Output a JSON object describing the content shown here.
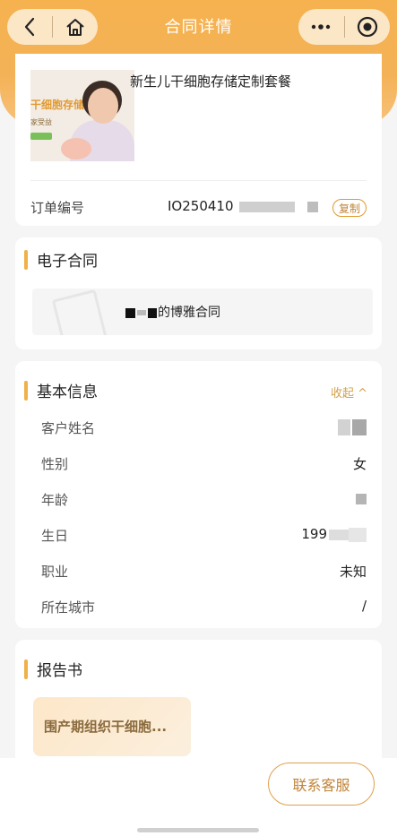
{
  "nav": {
    "title": "合同详情"
  },
  "product": {
    "name": "新生儿干细胞存储定制套餐",
    "image_text": "干细胞存储",
    "image_sub": "家受益",
    "order_label": "订单编号",
    "order_value": "IO250410",
    "copy_label": "复制"
  },
  "contract": {
    "section_title": "电子合同",
    "name": "的博雅合同"
  },
  "basic": {
    "section_title": "基本信息",
    "collapse_label": "收起 ^",
    "rows": [
      {
        "label": "客户姓名",
        "value": ""
      },
      {
        "label": "性别",
        "value": "女"
      },
      {
        "label": "年龄",
        "value": ""
      },
      {
        "label": "生日",
        "value": "199"
      },
      {
        "label": "职业",
        "value": "未知"
      },
      {
        "label": "所在城市",
        "value": "/"
      }
    ]
  },
  "report": {
    "section_title": "报告书",
    "item_title": "围产期组织干细胞..."
  },
  "footer": {
    "contact_label": "联系客服"
  },
  "colors": {
    "accent": "#f6b24f",
    "accent_text": "#c0843a",
    "bar": "#f0b04a"
  }
}
